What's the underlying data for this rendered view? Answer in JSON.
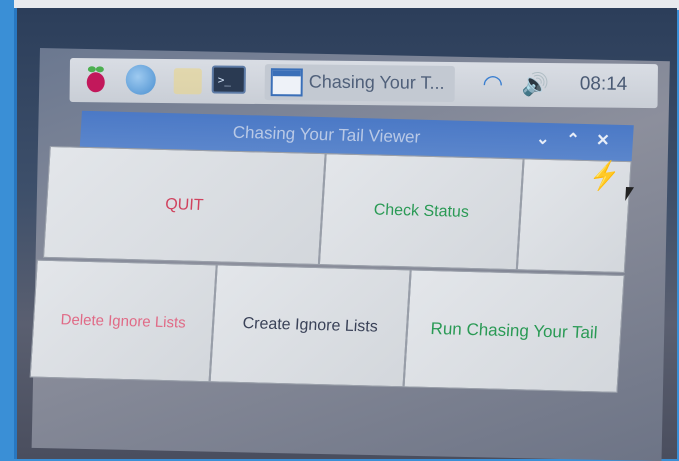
{
  "taskbar": {
    "task_label": "Chasing Your T...",
    "clock": "08:14",
    "icons": {
      "menu": "raspberry-icon",
      "browser": "globe-icon",
      "files": "folder-icon",
      "terminal": "terminal-icon",
      "wifi": "wifi-icon",
      "volume": "volume-icon"
    }
  },
  "window": {
    "title": "Chasing Your Tail Viewer",
    "controls": {
      "minimize": "⌄",
      "maximize": "⌃",
      "close": "✕"
    },
    "buttons": {
      "quit": "QUIT",
      "check_status": "Check Status",
      "delete_ignore": "Delete Ignore Lists",
      "create_ignore": "Create Ignore Lists",
      "run": "Run Chasing Your Tail"
    }
  },
  "colors": {
    "titlebar": "#4b79c6",
    "quit_text": "#d0425e",
    "green_text": "#2a9a55",
    "delete_text": "#e06a86"
  },
  "terminal_glyph": ">_"
}
